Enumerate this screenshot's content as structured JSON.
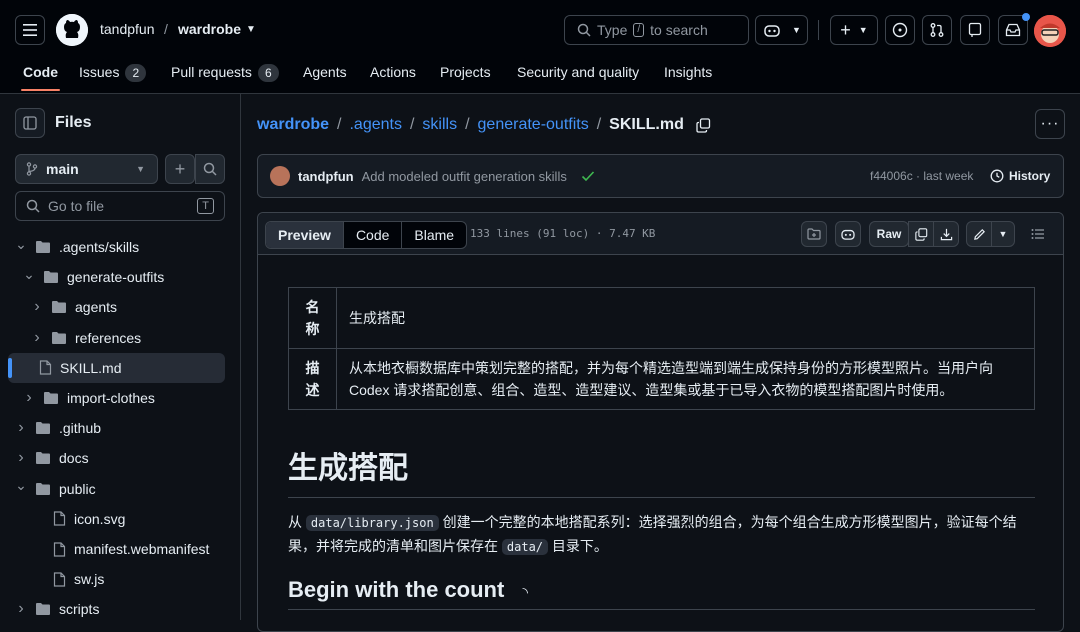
{
  "header": {
    "owner": "tandpfun",
    "separator": "/",
    "repo": "wardrobe",
    "search_placeholder": "Type",
    "search_key": "/",
    "search_suffix": "to search"
  },
  "repo_tabs": [
    {
      "label": "Code"
    },
    {
      "label": "Issues",
      "count": "2"
    },
    {
      "label": "Pull requests",
      "count": "6"
    },
    {
      "label": "Agents"
    },
    {
      "label": "Actions"
    },
    {
      "label": "Projects"
    },
    {
      "label": "Security and quality"
    },
    {
      "label": "Insights"
    }
  ],
  "sidebar": {
    "title": "Files",
    "branch": "main",
    "goto_placeholder": "Go to file",
    "goto_key": "T",
    "tree": [
      {
        "label": ".agents/skills",
        "type": "folder",
        "expanded": true
      },
      {
        "label": "generate-outfits",
        "type": "folder",
        "expanded": true
      },
      {
        "label": "agents",
        "type": "folder",
        "expanded": false
      },
      {
        "label": "references",
        "type": "folder",
        "expanded": false
      },
      {
        "label": "SKILL.md",
        "type": "file",
        "selected": true
      },
      {
        "label": "import-clothes",
        "type": "folder",
        "expanded": false
      },
      {
        "label": ".github",
        "type": "folder",
        "expanded": false
      },
      {
        "label": "docs",
        "type": "folder",
        "expanded": false
      },
      {
        "label": "public",
        "type": "folder",
        "expanded": true
      },
      {
        "label": "icon.svg",
        "type": "file"
      },
      {
        "label": "manifest.webmanifest",
        "type": "file"
      },
      {
        "label": "sw.js",
        "type": "file"
      },
      {
        "label": "scripts",
        "type": "folder",
        "expanded": false
      }
    ]
  },
  "breadcrumb": [
    "wardrobe",
    ".agents",
    "skills",
    "generate-outfits",
    "SKILL.md"
  ],
  "commit": {
    "author": "tandpfun",
    "message": "Add modeled outfit generation skills",
    "sha_time": "f44006c · last week",
    "history_label": "History"
  },
  "file": {
    "view_tabs": [
      "Preview",
      "Code",
      "Blame"
    ],
    "info": "133 lines (91 loc) · 7.47 KB",
    "raw_label": "Raw"
  },
  "content": {
    "meta": [
      {
        "key": "名称",
        "value": "生成搭配"
      },
      {
        "key": "描述",
        "value": "从本地衣橱数据库中策划完整的搭配，并为每个精选造型端到端生成保持身份的方形模型照片。当用户向 Codex 请求搭配创意、组合、造型、造型建议、造型集或基于已导入衣物的模型搭配图片时使用。"
      }
    ],
    "h1": "生成搭配",
    "para": {
      "p1": "从",
      "code1": "data/library.json",
      "p2": "创建一个完整的本地搭配系列：选择强烈的组合，为每个组合生成方形模型图片，验证每个结果，并将完成的清单和图片保存在",
      "code2": "data/",
      "p3": "目录下。"
    },
    "h2": "Begin with the count"
  }
}
